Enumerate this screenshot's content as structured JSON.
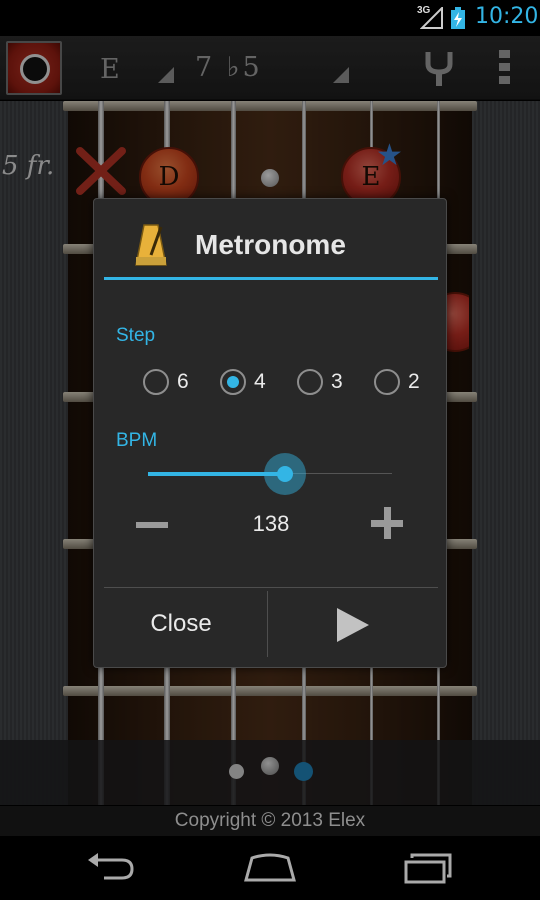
{
  "status_bar": {
    "network": "3G",
    "time": "10:20"
  },
  "toolbar": {
    "key": "E",
    "chord": "7 ♭5",
    "icons": {
      "app": "guitar-app-icon",
      "tuner": "tuning-fork-icon",
      "overflow": "overflow-menu-icon"
    }
  },
  "fretboard": {
    "fret_label": "5 fr.",
    "notes": [
      {
        "label": "D",
        "color": "#c8451e"
      },
      {
        "label": "E",
        "color": "#b52e24"
      }
    ],
    "icons": {
      "mute": "mute-x-icon",
      "root_marker": "star-icon"
    }
  },
  "dialog": {
    "title": "Metronome",
    "icon": "metronome-icon",
    "step_label": "Step",
    "step_options": [
      "6",
      "4",
      "3",
      "2"
    ],
    "step_selected": "4",
    "bpm_label": "BPM",
    "bpm_value": "138",
    "bpm_slider_fraction": 0.56,
    "close_label": "Close",
    "icons": {
      "decrease": "minus-icon",
      "increase": "plus-icon",
      "play": "play-icon"
    }
  },
  "pager": {
    "pages": 3,
    "current": 3
  },
  "copyright": "Copyright © 2013 Elex",
  "navbar": {
    "icons": [
      "back-icon",
      "home-icon",
      "recent-apps-icon"
    ]
  },
  "colors": {
    "accent": "#33b5e5",
    "dialog_bg": "#282828",
    "note_orange": "#c8451e",
    "note_red": "#b52e24",
    "star_blue": "#3b7fd1"
  }
}
